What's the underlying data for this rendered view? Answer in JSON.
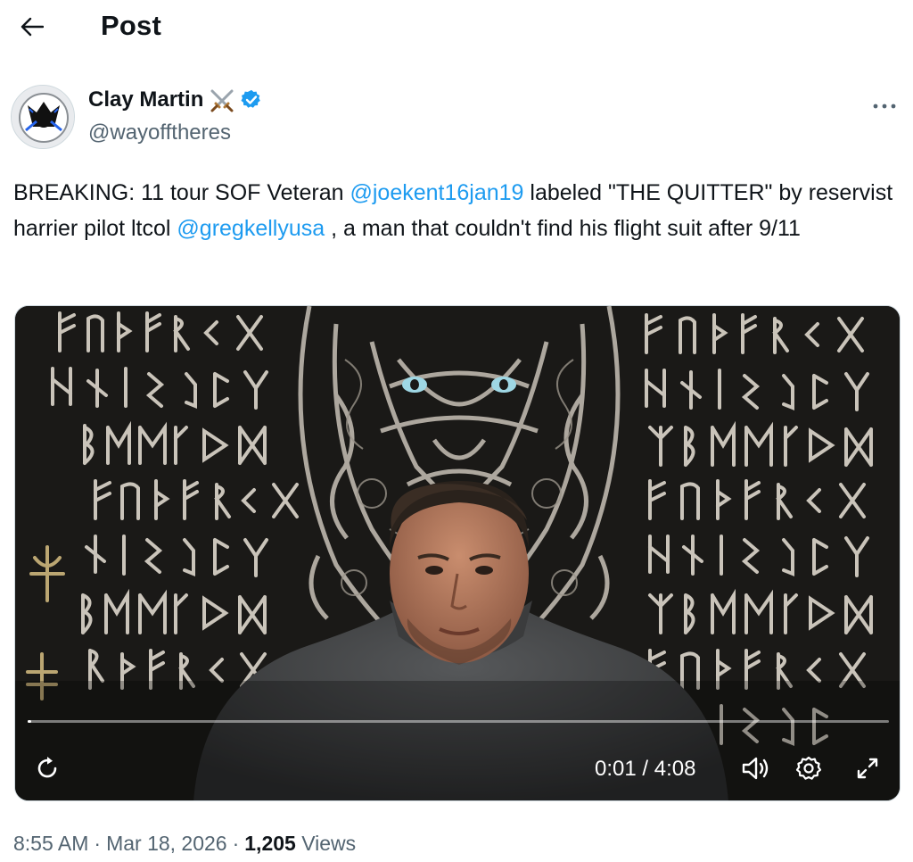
{
  "header": {
    "title": "Post",
    "back_icon": "arrow-left-icon"
  },
  "author": {
    "display_name": "Clay Martin",
    "name_emoji": "⚔️",
    "handle": "@wayofftheres",
    "verified": true,
    "verified_color": "#1d9bf0",
    "avatar_icon": "avatar-image",
    "more_icon": "more-horizontal-icon"
  },
  "tweet": {
    "segment_1": "BREAKING: 11 tour SOF Veteran ",
    "mention_1": "@joekent16jan19",
    "segment_2": " labeled \"THE QUITTER\" by reservist harrier pilot ltcol ",
    "mention_2": "@gregkellyusa",
    "segment_3": " , a man that couldn't find his flight suit after 9/11"
  },
  "video": {
    "current_time": "0:01",
    "separator": " / ",
    "duration": "4:08",
    "progress_fraction": 0.004,
    "controls": {
      "replay_icon": "replay-icon",
      "volume_icon": "volume-icon",
      "settings_icon": "gear-icon",
      "fullscreen_icon": "fullscreen-icon"
    }
  },
  "meta": {
    "time": "8:55 AM",
    "date": "Mar 18, 2026",
    "views_count": "1,205",
    "views_label": "Views",
    "separator": "·"
  },
  "colors": {
    "accent": "#1d9bf0",
    "text": "#0f1419",
    "secondary": "#536471"
  }
}
